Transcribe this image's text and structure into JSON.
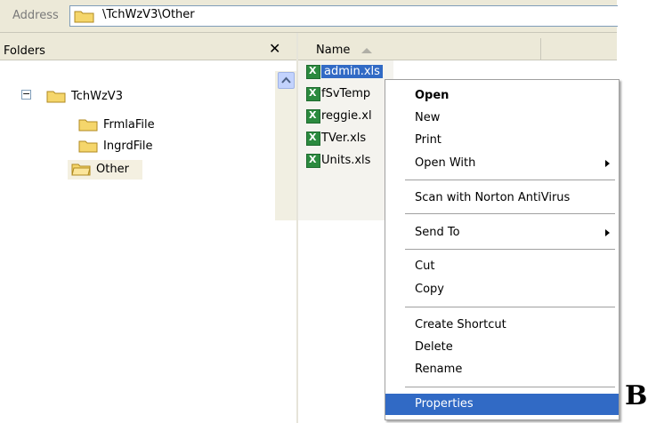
{
  "address": {
    "label": "Address",
    "path": "\\TchWzV3\\Other"
  },
  "folders_pane": {
    "title": "Folders",
    "close_symbol": "✕",
    "tree": {
      "expander": "−",
      "root": "TchWzV3",
      "children": [
        "FrmlaFile",
        "IngrdFile",
        "Other"
      ]
    }
  },
  "files_pane": {
    "column_name": "Name",
    "files": [
      "admin.xls",
      "fSvTemp",
      "reggie.xl",
      "TVer.xls",
      "Units.xls"
    ]
  },
  "context_menu": {
    "items": [
      {
        "label": "Open"
      },
      {
        "label": "New"
      },
      {
        "label": "Print"
      },
      {
        "label": "Open With"
      },
      {
        "label": "Scan with Norton AntiVirus"
      },
      {
        "label": "Send To"
      },
      {
        "label": "Cut"
      },
      {
        "label": "Copy"
      },
      {
        "label": "Create Shortcut"
      },
      {
        "label": "Delete"
      },
      {
        "label": "Rename"
      },
      {
        "label": "Properties"
      }
    ]
  },
  "annotation_letter": "B",
  "colors": {
    "selection": "#316ac5",
    "chrome": "#ece9d8",
    "folder": "#f5d66b",
    "excel_green": "#2b8a3e"
  }
}
